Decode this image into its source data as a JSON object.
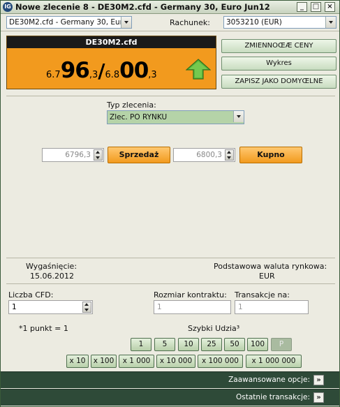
{
  "window": {
    "title": "Nowe zlecenie 8 - DE30M2.cfd - Germany 30, Euro Jun12",
    "app_icon": "logo-icon",
    "controls": {
      "minimize": "_",
      "restore": "□",
      "close": "×"
    }
  },
  "top": {
    "instrument_value": "DE30M2.cfd - Germany 30, Euro",
    "account_label": "Rachunek:",
    "account_value": "3053210 (EUR)"
  },
  "price": {
    "instrument": "DE30M2.cfd",
    "bid_prefix": "6.7",
    "bid_main": "96",
    "bid_sub": ",3",
    "slash": "/",
    "ask_prefix": "6.8",
    "ask_main": "00",
    "ask_sub": ",3",
    "trend_icon": "up-arrow-icon",
    "bg_color": "#f29a1e"
  },
  "side_buttons": {
    "changes": "ZMIENNOŒÆ CENY",
    "chart": "Wykres",
    "save_default": "ZAPISZ JAKO DOMYŒLNE"
  },
  "order_type": {
    "label": "Typ zlecenia:",
    "value": "Zlec. PO RYNKU"
  },
  "trade": {
    "sell_price": "6796,3",
    "sell_label": "Sprzedaż",
    "buy_price": "6800,3",
    "buy_label": "Kupno"
  },
  "info": {
    "expiry_label": "Wygaśnięcie:",
    "expiry_value": "15.06.2012",
    "currency_label": "Podstawowa waluta rynkowa:",
    "currency_value": "EUR"
  },
  "fields": {
    "cfd_count_label": "Liczba CFD:",
    "cfd_count_value": "1",
    "contract_size_label": "Rozmiar kontraktu:",
    "contract_size_value": "1",
    "transactions_label": "Transakcje na:",
    "transactions_value": "1",
    "point_note": "*1 punkt = 1",
    "quick_label": "Szybki Udzia³"
  },
  "quick_row1": [
    "1",
    "5",
    "10",
    "25",
    "50",
    "100",
    "P"
  ],
  "quick_row2": [
    "x 10",
    "x 100",
    "x 1 000",
    "x 10 000",
    "x 100 000",
    "x 1 000 000"
  ],
  "bottom": {
    "advanced": "Zaawansowane opcje:",
    "recent": "Ostatnie transakcje:",
    "bar_color": "#2e4a38"
  }
}
